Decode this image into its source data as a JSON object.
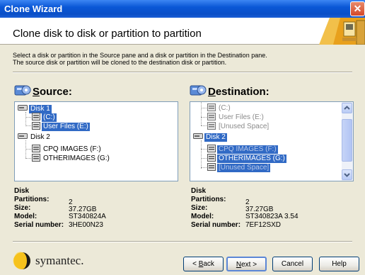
{
  "window": {
    "title": "Clone Wizard",
    "close_glyph": "✕"
  },
  "header": {
    "title": "Clone disk to disk or partition to partition"
  },
  "instructions": {
    "line1": "Select a disk or partition in the Source pane and a disk or partition in the Destination pane.",
    "line2": "The source disk or partition will be cloned to the destination disk or partition."
  },
  "source": {
    "heading_accel": "S",
    "heading_rest": "ource:",
    "tree": [
      {
        "label": "Disk 1",
        "state": "selected"
      },
      {
        "label": "(C:)",
        "state": "selected"
      },
      {
        "label": "User Files (E:)",
        "state": "selected"
      },
      {
        "label": "Disk 2",
        "state": "normal"
      },
      {
        "label": "CPQ IMAGES (F:)",
        "state": "normal"
      },
      {
        "label": "OTHERIMAGES (G:)",
        "state": "normal"
      }
    ],
    "info": {
      "kind": "Disk",
      "partitions_label": "Partitions:",
      "partitions": "2",
      "size_label": "Size:",
      "size": "37.27GB",
      "model_label": "Model:",
      "model": "ST340824A",
      "serial_label": "Serial number:",
      "serial": "3HE00N23"
    }
  },
  "destination": {
    "heading_accel": "D",
    "heading_rest": "estination:",
    "tree": [
      {
        "label": "(C:)",
        "state": "disabled"
      },
      {
        "label": "User Files (E:)",
        "state": "disabled"
      },
      {
        "label": "[Unused Space]",
        "state": "disabled"
      },
      {
        "label": "Disk 2",
        "state": "selected"
      },
      {
        "label": "CPQ IMAGES (F:)",
        "state": "selected-dim"
      },
      {
        "label": "OTHERIMAGES (G:)",
        "state": "selected"
      },
      {
        "label": "[Unused Space]",
        "state": "selected-dim"
      }
    ],
    "info": {
      "kind": "Disk",
      "partitions_label": "Partitions:",
      "partitions": "2",
      "size_label": "Size:",
      "size": "37.27GB",
      "model_label": "Model:",
      "model": "ST340823A 3.54",
      "serial_label": "Serial number:",
      "serial": "7EF12SXD"
    }
  },
  "footer": {
    "brand": "symantec.",
    "back": {
      "accel": "B",
      "rest": "ack",
      "prefix": "< "
    },
    "next": {
      "accel": "N",
      "rest": "ext >"
    },
    "cancel": "Cancel",
    "help": "Help"
  },
  "colors": {
    "selection": "#316ac5",
    "title_bar": "#0a57d6",
    "face": "#ece9d8"
  }
}
